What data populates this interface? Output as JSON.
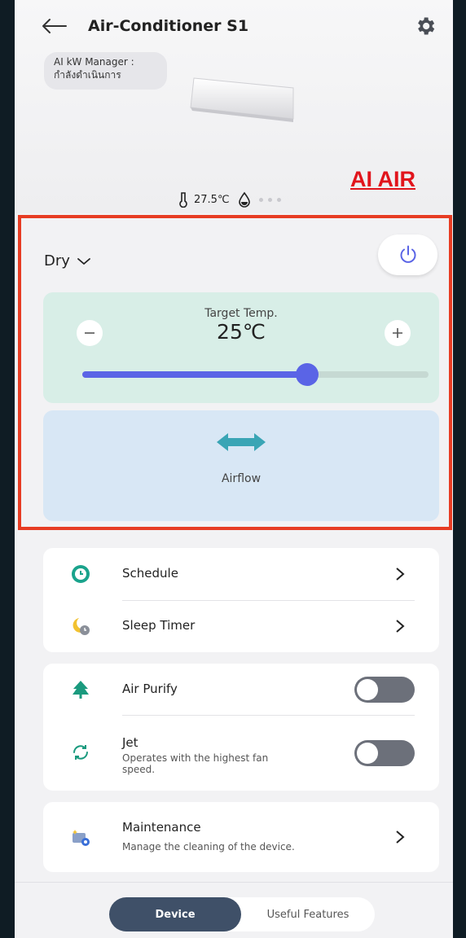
{
  "header": {
    "title": "Air-Conditioner S1"
  },
  "status": {
    "ai_kw_line1": "AI kW Manager :",
    "ai_kw_line2": "กำลังดำเนินการ",
    "temperature_reading": "27.5℃"
  },
  "annotation": {
    "label": "AI AIR",
    "color": "#e1141c"
  },
  "controls": {
    "mode": "Dry",
    "target_temp_label": "Target Temp.",
    "target_temp_value": "25℃",
    "slider_level": 0.65,
    "airflow_label": "Airflow"
  },
  "menu": {
    "schedule": "Schedule",
    "sleep_timer": "Sleep Timer",
    "air_purify": "Air Purify",
    "jet_title": "Jet",
    "jet_desc_line1": "Operates with the highest fan",
    "jet_desc_line2": "speed.",
    "maintenance_title": "Maintenance",
    "maintenance_desc": "Manage the cleaning of the device."
  },
  "toggles": {
    "air_purify_on": false,
    "jet_on": false
  },
  "bottom_nav": {
    "device": "Device",
    "useful_features": "Useful Features"
  },
  "colors": {
    "accent": "#5a64e6",
    "temp_card": "#d8eee7",
    "airflow_card": "#d8e7f5",
    "highlight_border": "#e73c23",
    "nav_active": "#3f5068",
    "airflow_icon": "#3aa5b5"
  },
  "icons": [
    "back-arrow-icon",
    "gear-icon",
    "thermometer-icon",
    "droplet-icon",
    "chevron-down-icon",
    "power-icon",
    "minus-icon",
    "plus-icon",
    "airflow-icon",
    "clock-icon",
    "moon-timer-icon",
    "tree-icon",
    "jet-swirl-icon",
    "maintenance-icon",
    "chevron-right-icon"
  ]
}
